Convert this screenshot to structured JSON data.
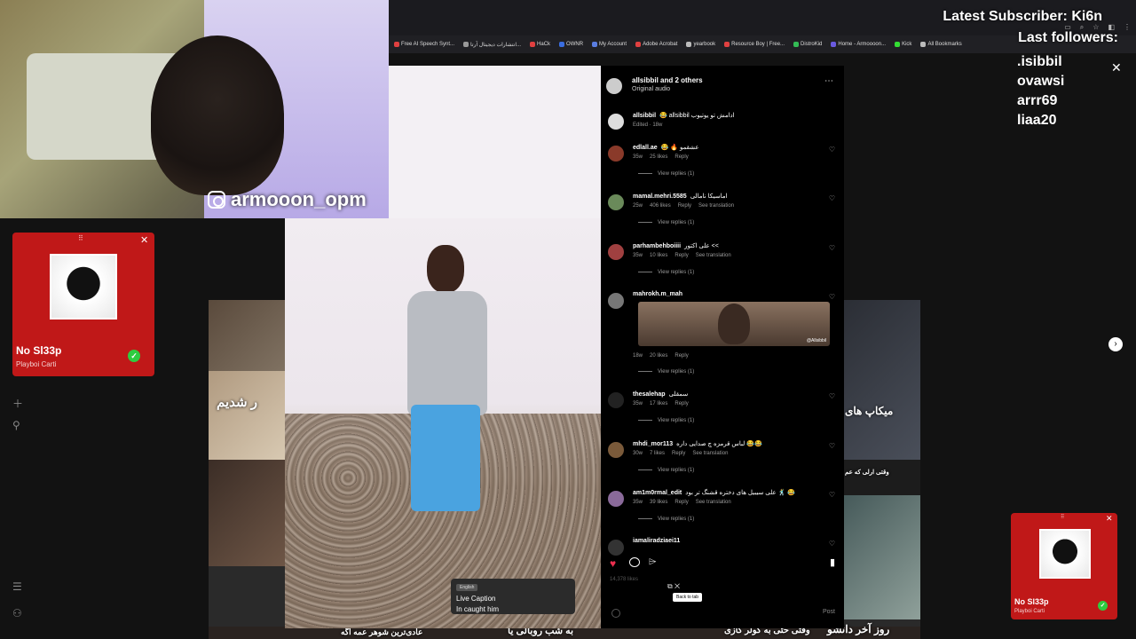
{
  "overlay": {
    "latest_subscriber": "Latest Subscriber: Ki6n",
    "last_followers_label": "Last followers:",
    "followers": [
      ".isibbil",
      "ovawsi",
      "arrr69",
      "liaa20"
    ]
  },
  "webcam": {
    "handle": "armooon_opm"
  },
  "bookmarks": [
    {
      "label": "Free AI Speech Synt...",
      "color": "#e04040"
    },
    {
      "label": "انتشارات دیجیتال آرتا...",
      "color": "#999999"
    },
    {
      "label": "HaCk",
      "color": "#e04040"
    },
    {
      "label": "OWNR",
      "color": "#3a6de0"
    },
    {
      "label": "My Account",
      "color": "#5a7de0"
    },
    {
      "label": "Adobe Acrobat",
      "color": "#e04040"
    },
    {
      "label": "yearbook",
      "color": "#bbbbbb"
    },
    {
      "label": "Resource Boy | Free...",
      "color": "#e04040"
    },
    {
      "label": "DistroKid",
      "color": "#33bb55"
    },
    {
      "label": "Home - Armoooon...",
      "color": "#6a5ae0"
    },
    {
      "label": "Kick",
      "color": "#33dd33"
    },
    {
      "label": "All Bookmarks",
      "color": "#bbbbbb"
    }
  ],
  "music_left": {
    "title": "No Sl33p",
    "artist": "Playboi Carti"
  },
  "music_right": {
    "title": "No Sl33p",
    "artist": "Playboi Carti"
  },
  "panel": {
    "header_user": "allsibbil and 2 others",
    "header_audio": "Original audio",
    "caption": {
      "user": "allsibbil",
      "text": "😂 allsibbil ادامش تو یوتیوب",
      "meta": "Edited · 18w"
    },
    "comments": [
      {
        "user": "edlall.ae",
        "text": "😂 🔥 عشقمو",
        "age": "35w",
        "likes": "25 likes",
        "reply": "Reply",
        "translate": "",
        "view": "View replies (1)"
      },
      {
        "user": "mamal.mehri.5585",
        "text": "اماسیکا نامالی",
        "age": "25w",
        "likes": "406 likes",
        "reply": "Reply",
        "translate": "See translation",
        "view": "View replies (1)"
      },
      {
        "user": "parhambehboiiii",
        "text": "علی اکتور << ",
        "age": "35w",
        "likes": "10 likes",
        "reply": "Reply",
        "translate": "See translation",
        "view": "View replies (1)"
      },
      {
        "user": "mahrokh.m_mah",
        "text": "",
        "age": "18w",
        "likes": "20 likes",
        "reply": "Reply",
        "translate": "",
        "view": "View replies (1)",
        "image_watermark": "@Allsibbil"
      },
      {
        "user": "thesalehap",
        "text": "سمقلی",
        "age": "35w",
        "likes": "17 likes",
        "reply": "Reply",
        "translate": "",
        "view": "View replies (1)"
      },
      {
        "user": "mhdi_mor113",
        "text": "لباس قرمزه چ صدایی داره 😂😂",
        "age": "30w",
        "likes": "7 likes",
        "reply": "Reply",
        "translate": "See translation",
        "view": "View replies (1)"
      },
      {
        "user": "am1m0rmal_edit",
        "text": "علی سیبیل های دختره قشنگ تر بود 🕺 😂",
        "age": "35w",
        "likes": "39 likes",
        "reply": "Reply",
        "translate": "See translation",
        "view": "View replies (1)"
      },
      {
        "user": "iamaliradziaei11",
        "text": "",
        "age": "",
        "likes": "",
        "reply": "",
        "translate": "",
        "view": ""
      }
    ],
    "post_label": "Post",
    "likes_count": "14,378 likes"
  },
  "caption_box": {
    "language": "English",
    "title": "Live Caption",
    "text": "In caught him"
  },
  "tooltip": "Back to tab",
  "thumb_overlays": {
    "left1": "ر شدیم",
    "right1": "میکاپ های",
    "right2": "وقتی ارلی که عم",
    "bottom1": "عادی‌ترین شوهر عمه اگه",
    "bottom2": "به شب روبالی یا",
    "bottom3": "وقتی حتی به کولر گازی",
    "bottom4": "روز آخر دانشو"
  }
}
